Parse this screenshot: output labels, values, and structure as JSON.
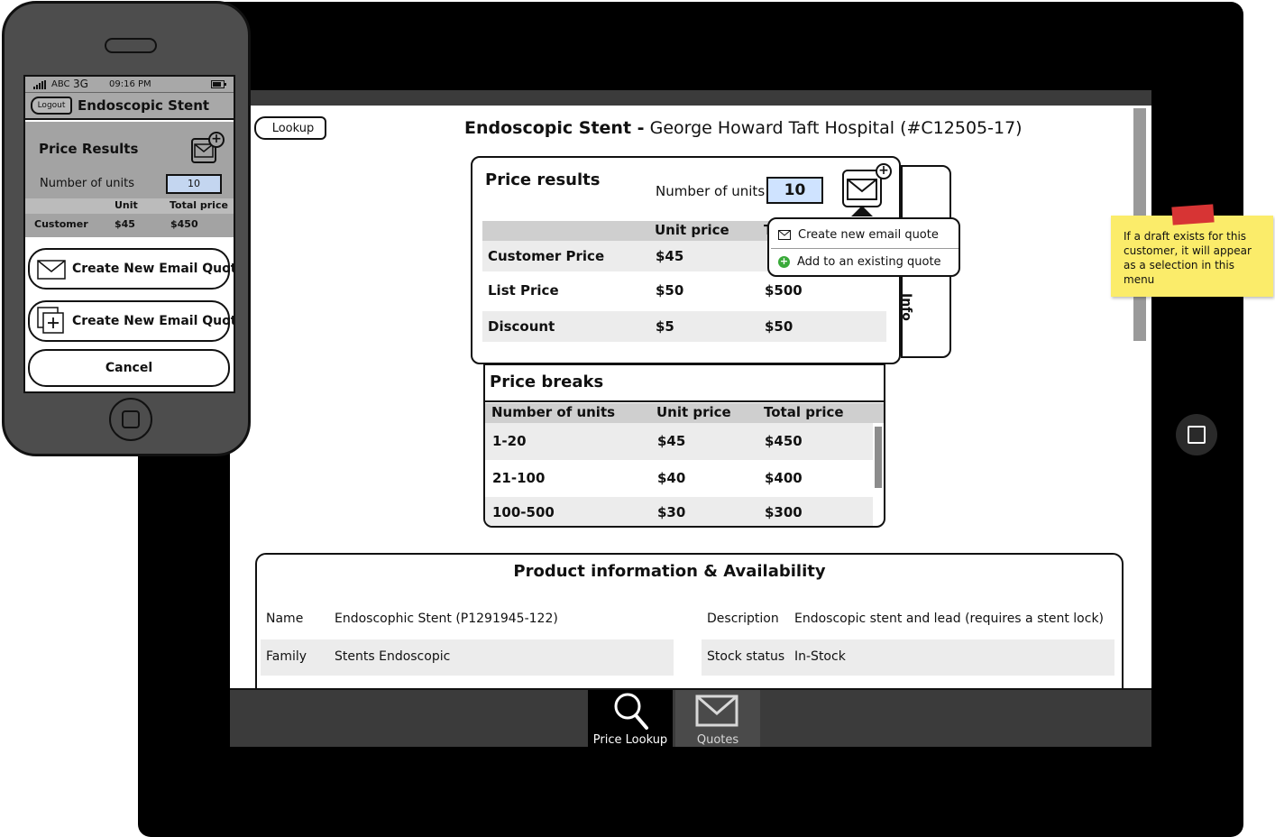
{
  "tablet": {
    "lookup_label": "Lookup",
    "heading_product": "Endoscopic Stent -",
    "heading_customer": "George Howard Taft Hospital (#C12505-17)",
    "price_results": {
      "title": "Price results",
      "units_label": "Number of units",
      "units_value": "10",
      "col_unit": "Unit price",
      "col_total": "T",
      "rows": [
        {
          "label": "Customer Price",
          "unit": "$45",
          "total": ""
        },
        {
          "label": "List Price",
          "unit": "$50",
          "total": "$500"
        },
        {
          "label": "Discount",
          "unit": "$5",
          "total": "$50"
        }
      ]
    },
    "info_tab": "Info",
    "dropdown": {
      "item1": "Create new email quote",
      "item2": "Add to an existing quote"
    },
    "price_breaks": {
      "title": "Price breaks",
      "col_units": "Number of units",
      "col_unit": "Unit price",
      "col_total": "Total price",
      "rows": [
        {
          "units": "1-20",
          "unit": "$45",
          "total": "$450"
        },
        {
          "units": "21-100",
          "unit": "$40",
          "total": "$400"
        },
        {
          "units": "100-500",
          "unit": "$30",
          "total": "$300"
        }
      ]
    },
    "product_info": {
      "title": "Product information & Availability",
      "name_label": "Name",
      "name_value": "Endoscophic Stent (P1291945-122)",
      "family_label": "Family",
      "family_value": "Stents Endoscopic",
      "description_label": "Description",
      "description_value": "Endoscopic stent and lead (requires a stent lock)",
      "stock_label": "Stock status",
      "stock_value": "In-Stock"
    },
    "tabs": {
      "price_lookup": "Price Lookup",
      "quotes": "Quotes"
    }
  },
  "sticky_note": "If a draft exists for this customer, it will appear as a selection in this menu",
  "phone": {
    "carrier": "ABC",
    "network": "3G",
    "time": "09:16 PM",
    "logout": "Logout",
    "title": "Endoscopic Stent",
    "price_results": "Price Results",
    "units_label": "Number of units",
    "units_value": "10",
    "col_unit": "Unit",
    "col_total": "Total price",
    "row_label": "Customer",
    "row_unit": "$45",
    "row_total": "$450",
    "btn_new_quote": "Create New Email Quote",
    "btn_add_quote": "Create New Email Quote",
    "btn_cancel": "Cancel"
  },
  "colors": {
    "units_input_bg": "#cfe3ff",
    "add_icon": "#3aaa3a",
    "sticky": "#fbec6a",
    "tape": "#d73434"
  }
}
